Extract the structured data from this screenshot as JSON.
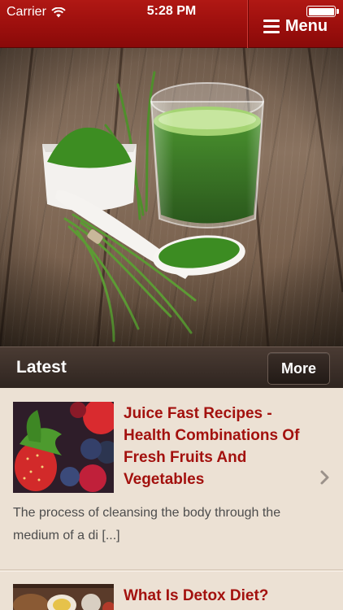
{
  "status_bar": {
    "carrier": "Carrier",
    "time": "5:28 PM",
    "wifi_icon": "wifi-icon",
    "battery_icon": "battery-icon"
  },
  "header": {
    "menu_label": "Menu",
    "menu_icon": "hamburger-icon",
    "background_color": "#9c0f0d"
  },
  "hero": {
    "image": "hero-image",
    "subject": "green-juice-glass"
  },
  "section": {
    "title": "Latest",
    "more_label": "More"
  },
  "articles": [
    {
      "title": "Juice Fast Recipes - Health Combinations Of Fresh Fruits And Vegetables",
      "excerpt": "The process of cleansing the body through the medium of a di [...]",
      "thumbnail": "berries-thumbnail",
      "chevron": "chevron-right-icon"
    },
    {
      "title": "What Is Detox Diet?",
      "thumbnail": "detox-foods-thumbnail"
    }
  ],
  "colors": {
    "accent": "#a3110e",
    "page_background": "#ece1d4",
    "section_bar": "#3a2e28"
  }
}
